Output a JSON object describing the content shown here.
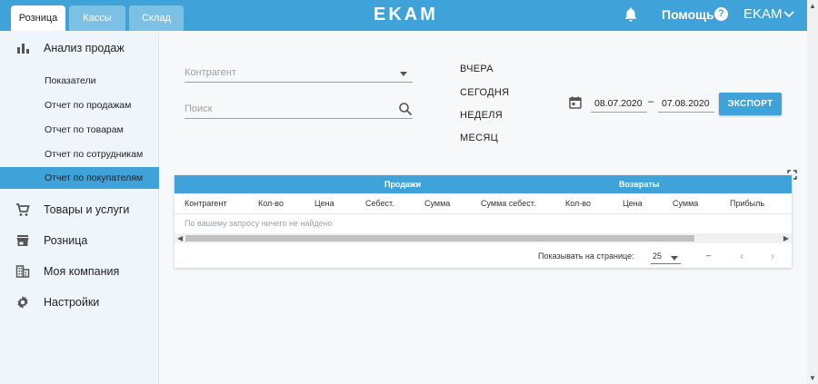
{
  "header": {
    "tabs": [
      {
        "label": "Розница",
        "active": true
      },
      {
        "label": "Кассы",
        "active": false
      },
      {
        "label": "Склад",
        "active": false
      }
    ],
    "logo": "EKAM",
    "help_label": "Помощь",
    "help_icon": "?",
    "user_label": "EKAM"
  },
  "sidebar": {
    "sections": [
      {
        "label": "Анализ продаж",
        "icon": "bar-chart-icon"
      },
      {
        "label": "Товары и услуги",
        "icon": "cart-icon"
      },
      {
        "label": "Розница",
        "icon": "store-icon"
      },
      {
        "label": "Моя компания",
        "icon": "building-icon"
      },
      {
        "label": "Настройки",
        "icon": "gear-icon"
      }
    ],
    "subitems": [
      {
        "label": "Показатели",
        "active": false
      },
      {
        "label": "Отчет по продажам",
        "active": false
      },
      {
        "label": "Отчет по товарам",
        "active": false
      },
      {
        "label": "Отчет по сотрудникам",
        "active": false
      },
      {
        "label": "Отчет по покупателям",
        "active": true
      }
    ]
  },
  "filters": {
    "contractor_placeholder": "Контрагент",
    "search_placeholder": "Поиск",
    "periods": [
      "ВЧЕРА",
      "СЕГОДНЯ",
      "НЕДЕЛЯ",
      "МЕСЯЦ"
    ],
    "date_from": "08.07.2020",
    "date_separator": "–",
    "date_to": "07.08.2020",
    "export_label": "ЭКСПОРТ"
  },
  "table": {
    "group_sales": "Продажи",
    "group_returns": "Возвраты",
    "columns": [
      "Контрагент",
      "Кол-во",
      "Цена",
      "Себест.",
      "Сумма",
      "Сумма себест.",
      "Кол-во",
      "Цена",
      "Сумма",
      "Прибыль"
    ],
    "empty_message": "По вашему запросу ничего не найдено",
    "pager": {
      "label": "Показывать на странице:",
      "page_size": "25",
      "range": "–"
    }
  },
  "colors": {
    "brand": "#3fa2d8",
    "sidebar_bg": "#eef6fb",
    "page_bg": "#f7f8f9"
  }
}
